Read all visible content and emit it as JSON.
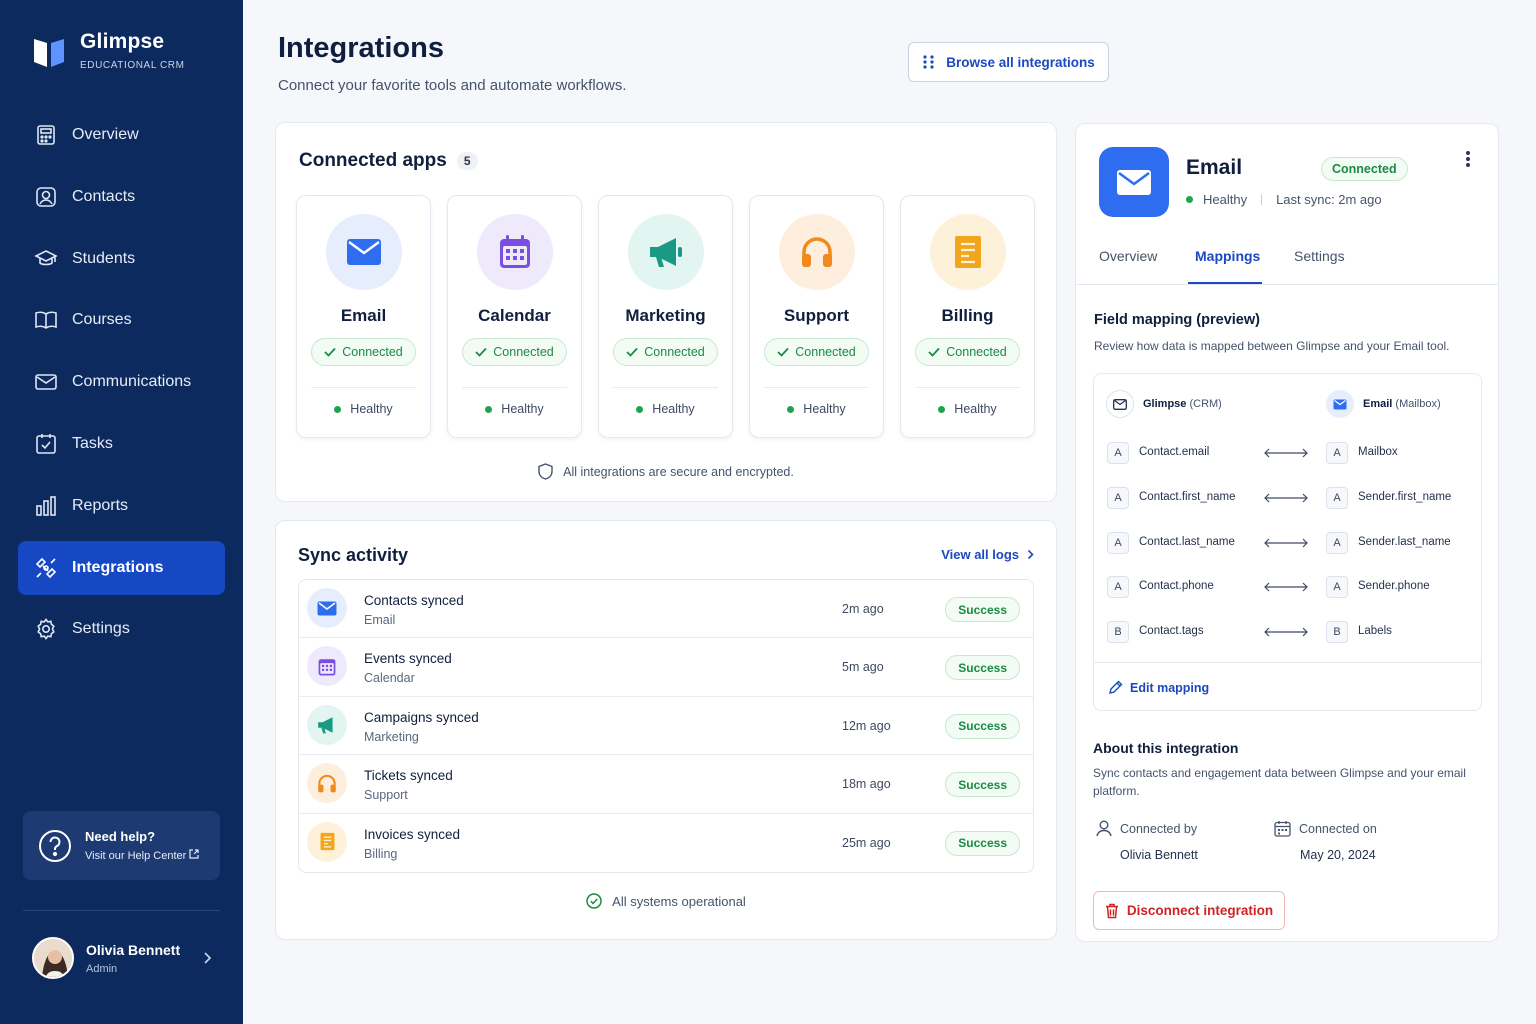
{
  "brand": {
    "name": "Glimpse",
    "subtitle": "EDUCATIONAL CRM"
  },
  "sidebar": {
    "items": [
      {
        "label": "Overview",
        "icon": "overview-icon"
      },
      {
        "label": "Contacts",
        "icon": "contacts-icon"
      },
      {
        "label": "Students",
        "icon": "students-icon"
      },
      {
        "label": "Courses",
        "icon": "courses-icon"
      },
      {
        "label": "Communications",
        "icon": "mail-icon"
      },
      {
        "label": "Tasks",
        "icon": "tasks-icon"
      },
      {
        "label": "Reports",
        "icon": "reports-icon"
      },
      {
        "label": "Integrations",
        "icon": "integrations-icon",
        "active": true
      },
      {
        "label": "Settings",
        "icon": "settings-icon"
      }
    ],
    "help": {
      "title": "Need help?",
      "link": "Visit our Help Center"
    },
    "user": {
      "name": "Olivia Bennett",
      "role": "Admin"
    }
  },
  "header": {
    "title": "Integrations",
    "subtitle": "Connect your favorite tools and automate workflows.",
    "browse_label": "Browse all integrations"
  },
  "apps": {
    "title": "Connected apps",
    "count": "5",
    "items": [
      {
        "name": "Email",
        "status": "Connected",
        "health": "Healthy",
        "icon": "mail-icon",
        "color": "#2f6df0",
        "bg": "#e6eefd"
      },
      {
        "name": "Calendar",
        "status": "Connected",
        "health": "Healthy",
        "icon": "calendar-icon",
        "color": "#7a4ee0",
        "bg": "#efe9fc"
      },
      {
        "name": "Marketing",
        "status": "Connected",
        "health": "Healthy",
        "icon": "megaphone-icon",
        "color": "#1a9a82",
        "bg": "#e3f5f0"
      },
      {
        "name": "Support",
        "status": "Connected",
        "health": "Healthy",
        "icon": "headphones-icon",
        "color": "#f08a1c",
        "bg": "#fdeedd"
      },
      {
        "name": "Billing",
        "status": "Connected",
        "health": "Healthy",
        "icon": "invoice-icon",
        "color": "#f2a61b",
        "bg": "#fdf1d9"
      }
    ],
    "secure_note": "All integrations are secure and encrypted."
  },
  "sync": {
    "title": "Sync activity",
    "view_all": "View all logs",
    "rows": [
      {
        "name": "Contacts synced",
        "source": "Email",
        "time": "2m ago",
        "status": "Success",
        "icon": "mail-icon",
        "color": "#2f6df0",
        "bg": "#e6eefd"
      },
      {
        "name": "Events synced",
        "source": "Calendar",
        "time": "5m ago",
        "status": "Success",
        "icon": "calendar-icon",
        "color": "#7a4ee0",
        "bg": "#efe9fc"
      },
      {
        "name": "Campaigns synced",
        "source": "Marketing",
        "time": "12m ago",
        "status": "Success",
        "icon": "megaphone-icon",
        "color": "#1a9a82",
        "bg": "#e3f5f0"
      },
      {
        "name": "Tickets synced",
        "source": "Support",
        "time": "18m ago",
        "status": "Success",
        "icon": "headphones-icon",
        "color": "#f08a1c",
        "bg": "#fdeedd"
      },
      {
        "name": "Invoices synced",
        "source": "Billing",
        "time": "25m ago",
        "status": "Success",
        "icon": "invoice-icon",
        "color": "#f2a61b",
        "bg": "#fdf1d9"
      }
    ],
    "ops_note": "All systems operational"
  },
  "detail": {
    "name": "Email",
    "badge": "Connected",
    "health": "Healthy",
    "last_sync": "Last sync: 2m ago",
    "tabs": [
      "Overview",
      "Mappings",
      "Settings"
    ],
    "active_tab": "Mappings",
    "mapping": {
      "title": "Field mapping (preview)",
      "subtitle": "Review how data is mapped between Glimpse and your Email tool.",
      "left_head": {
        "name": "Glimpse",
        "suffix": "(CRM)"
      },
      "right_head": {
        "name": "Email",
        "suffix": "(Mailbox)"
      },
      "rows": [
        {
          "left_type": "A",
          "left": "Contact.email",
          "right_type": "A",
          "right": "Mailbox"
        },
        {
          "left_type": "A",
          "left": "Contact.first_name",
          "right_type": "A",
          "right": "Sender.first_name"
        },
        {
          "left_type": "A",
          "left": "Contact.last_name",
          "right_type": "A",
          "right": "Sender.last_name"
        },
        {
          "left_type": "A",
          "left": "Contact.phone",
          "right_type": "A",
          "right": "Sender.phone"
        },
        {
          "left_type": "B",
          "left": "Contact.tags",
          "right_type": "B",
          "right": "Labels"
        }
      ],
      "edit_label": "Edit mapping"
    },
    "about": {
      "title": "About this integration",
      "text": "Sync contacts and engagement data between Glimpse and your email platform.",
      "connected_by_label": "Connected by",
      "connected_by": "Olivia Bennett",
      "connected_on_label": "Connected on",
      "connected_on": "May 20, 2024"
    },
    "disconnect_label": "Disconnect integration"
  },
  "colors": {
    "sidebar": "#0d2a5e",
    "accent": "#1a49c0",
    "success": "#1c8a43",
    "danger": "#d02424"
  }
}
